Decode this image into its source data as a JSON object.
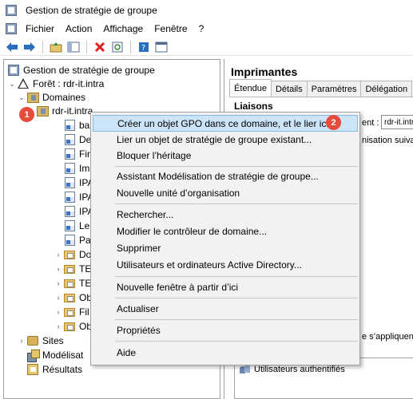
{
  "window": {
    "title": "Gestion de stratégie de groupe"
  },
  "menu": {
    "items": [
      "Fichier",
      "Action",
      "Affichage",
      "Fenêtre",
      "?"
    ]
  },
  "toolbar": {
    "icons": [
      "back-arrow-icon",
      "forward-arrow-icon",
      "folder-up-icon",
      "show-hide-tree-icon",
      "delete-icon",
      "refresh-icon",
      "help-icon",
      "console-icon"
    ]
  },
  "tree": {
    "root": "Gestion de stratégie de groupe",
    "forest": "Forêt : rdr-it.intra",
    "domains": "Domaines",
    "domain": "rdr-it.intra",
    "children": [
      "ba",
      "De",
      "Fir",
      "Im",
      "IPA",
      "IPA",
      "IPA",
      "Le",
      "Pa",
      "Do",
      "TE",
      "TE",
      "Ob",
      "Fil",
      "Ob"
    ],
    "sites": "Sites",
    "modeling": "Modélisat",
    "results": "Résultats"
  },
  "badges": {
    "one": "1",
    "two": "2"
  },
  "context_menu": {
    "items": [
      "Créer un objet GPO dans ce domaine, et le lier ici...",
      "Lier un objet de stratégie de groupe existant...",
      "Bloquer l’héritage",
      "Assistant Modélisation de stratégie de groupe...",
      "Nouvelle unité d’organisation",
      "Rechercher...",
      "Modifier le contrôleur de domaine...",
      "Supprimer",
      "Utilisateurs et ordinateurs Active Directory...",
      "Nouvelle fenêtre à partir d’ici",
      "Actualiser",
      "Propriétés",
      "Aide"
    ],
    "highlighted_index": 0
  },
  "right_pane": {
    "title": "Imprimantes",
    "tabs": [
      "Étendue",
      "Détails",
      "Paramètres",
      "Délégation"
    ],
    "active_tab": "Étendue",
    "section_links": "Liaisons",
    "location_label_suffix": "ent :",
    "location_value": "rdr-it.intra",
    "column_fragment": "nisation suivant",
    "filter_fragment": "e s’appliquent u",
    "security_filter_entry": "Utilisateurs authentifiés"
  },
  "colors": {
    "highlight": "#cce4f7",
    "badge": "#e84a3b",
    "menu_bg": "#f2f2f2"
  }
}
